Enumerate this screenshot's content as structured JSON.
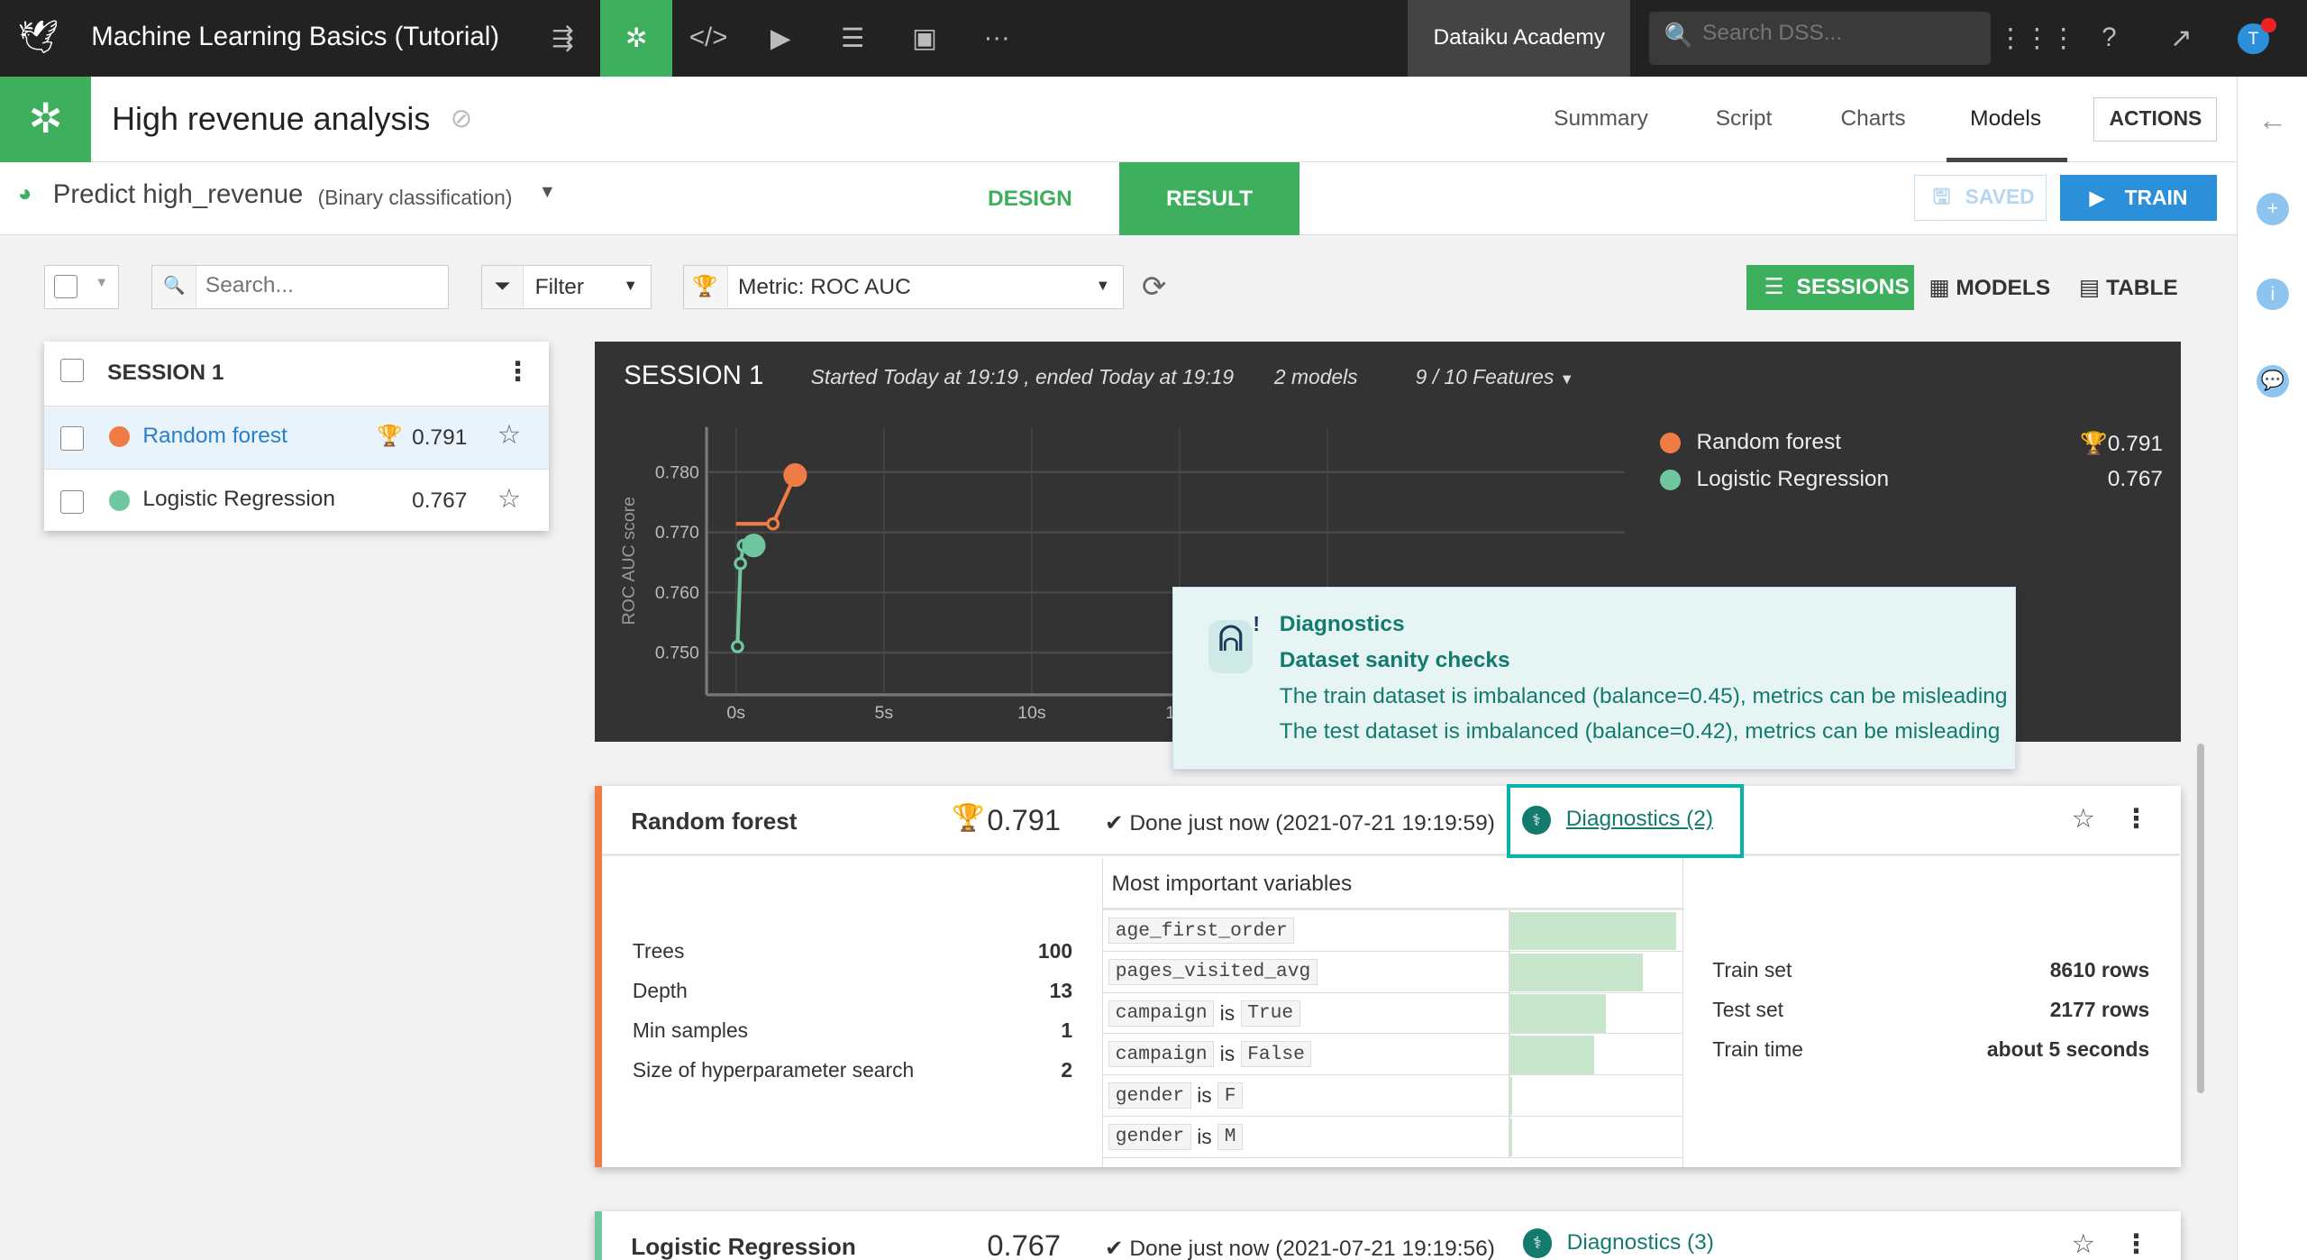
{
  "topbar": {
    "project_title": "Machine Learning Basics (Tutorial)",
    "academy": "Dataiku Academy",
    "search_placeholder": "Search DSS...",
    "avatar": "T"
  },
  "analysis": {
    "title": "High revenue analysis",
    "tabs": [
      "Summary",
      "Script",
      "Charts",
      "Models"
    ],
    "active_tab": "Models",
    "actions": "ACTIONS"
  },
  "task": {
    "name": "Predict high_revenue",
    "type": "(Binary classification)",
    "design": "DESIGN",
    "result": "RESULT",
    "saved": "SAVED",
    "train": "TRAIN"
  },
  "toolbar": {
    "search_placeholder": "Search...",
    "filter": "Filter",
    "metric": "Metric: ROC AUC",
    "sessions": "SESSIONS",
    "models": "MODELS",
    "table": "TABLE"
  },
  "session_list": {
    "title": "SESSION 1",
    "models": [
      {
        "name": "Random forest",
        "score": "0.791",
        "color": "#f07c45",
        "best": true
      },
      {
        "name": "Logistic Regression",
        "score": "0.767",
        "color": "#6fc7a0",
        "best": false
      }
    ]
  },
  "session_panel": {
    "title": "SESSION 1",
    "times": "Started Today at 19:19 , ended Today at 19:19",
    "models": "2 models",
    "features": "9 / 10 Features"
  },
  "chart_data": {
    "type": "line",
    "ylabel": "ROC AUC score",
    "xlabel": "",
    "x_ticks": [
      "0s",
      "5s",
      "10s",
      "15s"
    ],
    "y_ticks": [
      "0.750",
      "0.760",
      "0.770",
      "0.780"
    ],
    "xlim": [
      -0.5,
      20
    ],
    "ylim": [
      0.743,
      0.7875
    ],
    "grid": true,
    "legend": "right",
    "series": [
      {
        "name": "Random forest",
        "color": "#f07c45",
        "score": "0.791",
        "points": [
          [
            0,
            0.7714
          ],
          [
            1.25,
            0.7714
          ],
          [
            2.0,
            0.7795
          ]
        ]
      },
      {
        "name": "Logistic Regression",
        "color": "#6fc7a0",
        "score": "0.767",
        "points": [
          [
            0.05,
            0.751
          ],
          [
            0.15,
            0.7648
          ],
          [
            0.25,
            0.7678
          ],
          [
            0.6,
            0.7678
          ]
        ]
      }
    ]
  },
  "tooltip": {
    "title": "Diagnostics",
    "subtitle": "Dataset sanity checks",
    "lines": [
      "The train dataset is imbalanced (balance=0.45), metrics can be misleading",
      "The test dataset is imbalanced (balance=0.42), metrics can be misleading"
    ]
  },
  "rf_card": {
    "name": "Random forest",
    "score": "0.791",
    "status": "Done just now (2021-07-21 19:19:59)",
    "diagnostics": "Diagnostics (2)",
    "params": [
      {
        "k": "Trees",
        "v": "100"
      },
      {
        "k": "Depth",
        "v": "13"
      },
      {
        "k": "Min samples",
        "v": "1"
      },
      {
        "k": "Size of hyperparameter search",
        "v": "2"
      }
    ],
    "variables_title": "Most important variables",
    "variables": [
      {
        "parts": [
          "age_first_order"
        ],
        "importance": 1.0
      },
      {
        "parts": [
          "pages_visited_avg"
        ],
        "importance": 0.8
      },
      {
        "parts": [
          "campaign",
          "is",
          "True"
        ],
        "importance": 0.58
      },
      {
        "parts": [
          "campaign",
          "is",
          "False"
        ],
        "importance": 0.51
      },
      {
        "parts": [
          "gender",
          "is",
          "F"
        ],
        "importance": 0.02
      },
      {
        "parts": [
          "gender",
          "is",
          "M"
        ],
        "importance": 0.0
      }
    ],
    "stats": [
      {
        "k": "Train set",
        "v": "8610 rows"
      },
      {
        "k": "Test set",
        "v": "2177 rows"
      },
      {
        "k": "Train time",
        "v": "about 5 seconds"
      }
    ]
  },
  "lr_card": {
    "name": "Logistic Regression",
    "score": "0.767",
    "status": "Done just now (2021-07-21 19:19:56)",
    "diagnostics": "Diagnostics (3)"
  }
}
